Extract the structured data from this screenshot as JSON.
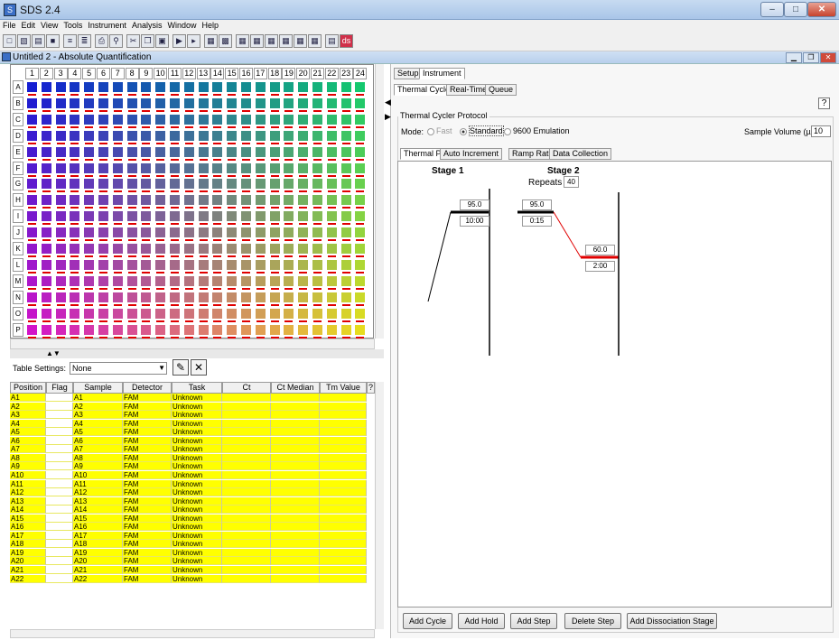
{
  "app": {
    "title": "SDS 2.4",
    "icon": "sds-app-icon"
  },
  "menu": [
    "File",
    "Edit",
    "View",
    "Tools",
    "Instrument",
    "Analysis",
    "Window",
    "Help"
  ],
  "document": {
    "title": "Untitled 2 - Absolute Quantification"
  },
  "plate": {
    "columns": [
      "1",
      "2",
      "3",
      "4",
      "5",
      "6",
      "7",
      "8",
      "9",
      "10",
      "11",
      "12",
      "13",
      "14",
      "15",
      "16",
      "17",
      "18",
      "19",
      "20",
      "21",
      "22",
      "23",
      "24"
    ],
    "rows": [
      "A",
      "B",
      "C",
      "D",
      "E",
      "F",
      "G",
      "H",
      "I",
      "J",
      "K",
      "L",
      "M",
      "N",
      "O",
      "P"
    ]
  },
  "table_settings": {
    "label": "Table Settings:",
    "value": "None"
  },
  "table": {
    "headers": [
      "Position",
      "Flag",
      "Sample",
      "Detector",
      "Task",
      "Ct",
      "Ct Median",
      "Tm Value",
      "?"
    ],
    "rows": [
      [
        "A1",
        "",
        "A1",
        "FAM",
        "Unknown"
      ],
      [
        "A2",
        "",
        "A2",
        "FAM",
        "Unknown"
      ],
      [
        "A3",
        "",
        "A3",
        "FAM",
        "Unknown"
      ],
      [
        "A4",
        "",
        "A4",
        "FAM",
        "Unknown"
      ],
      [
        "A5",
        "",
        "A5",
        "FAM",
        "Unknown"
      ],
      [
        "A6",
        "",
        "A6",
        "FAM",
        "Unknown"
      ],
      [
        "A7",
        "",
        "A7",
        "FAM",
        "Unknown"
      ],
      [
        "A8",
        "",
        "A8",
        "FAM",
        "Unknown"
      ],
      [
        "A9",
        "",
        "A9",
        "FAM",
        "Unknown"
      ],
      [
        "A10",
        "",
        "A10",
        "FAM",
        "Unknown"
      ],
      [
        "A11",
        "",
        "A11",
        "FAM",
        "Unknown"
      ],
      [
        "A12",
        "",
        "A12",
        "FAM",
        "Unknown"
      ],
      [
        "A13",
        "",
        "A13",
        "FAM",
        "Unknown"
      ],
      [
        "A14",
        "",
        "A14",
        "FAM",
        "Unknown"
      ],
      [
        "A15",
        "",
        "A15",
        "FAM",
        "Unknown"
      ],
      [
        "A16",
        "",
        "A16",
        "FAM",
        "Unknown"
      ],
      [
        "A17",
        "",
        "A17",
        "FAM",
        "Unknown"
      ],
      [
        "A18",
        "",
        "A18",
        "FAM",
        "Unknown"
      ],
      [
        "A19",
        "",
        "A19",
        "FAM",
        "Unknown"
      ],
      [
        "A20",
        "",
        "A20",
        "FAM",
        "Unknown"
      ],
      [
        "A21",
        "",
        "A21",
        "FAM",
        "Unknown"
      ],
      [
        "A22",
        "",
        "A22",
        "FAM",
        "Unknown"
      ]
    ]
  },
  "right": {
    "top_tabs": [
      "Setup",
      "Instrument"
    ],
    "sub_tabs": [
      "Thermal Cycler",
      "Real-Time",
      "Queue"
    ],
    "help": "?",
    "protocol_label": "Thermal Cycler Protocol",
    "mode_label": "Mode:",
    "modes": [
      "Fast",
      "Standard",
      "9600 Emulation"
    ],
    "sample_volume_label": "Sample Volume (µL):",
    "sample_volume": "10",
    "profile_tabs": [
      "Thermal Profile",
      "Auto Increment",
      "Ramp Rate",
      "Data Collection"
    ],
    "stage1": "Stage 1",
    "stage2": "Stage 2",
    "repeats_label": "Repeats",
    "repeats": "40",
    "steps": [
      {
        "temp": "95.0",
        "time": "10:00"
      },
      {
        "temp": "95.0",
        "time": "0:15"
      },
      {
        "temp": "60.0",
        "time": "2:00"
      }
    ],
    "buttons": [
      "Add Cycle",
      "Add Hold",
      "Add Step",
      "Delete Step",
      "Add Dissociation Stage"
    ]
  }
}
